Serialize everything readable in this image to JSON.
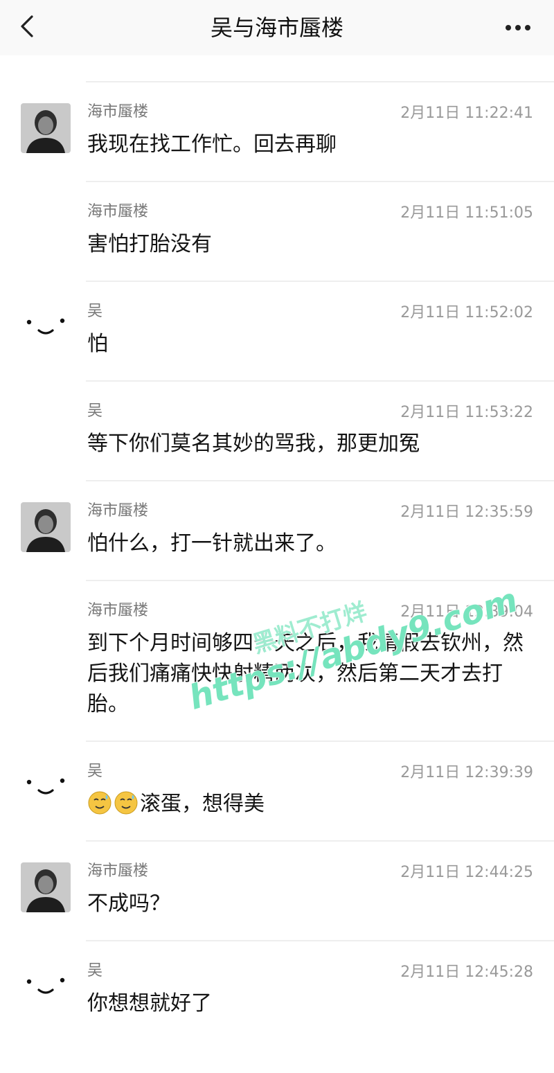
{
  "header": {
    "title": "吴与海市蜃楼"
  },
  "colors": {
    "header_bg": "#f9f9f9",
    "divider": "#eeeeee",
    "name_text": "#777777",
    "time_text": "#999999",
    "watermark": "#50dcaa"
  },
  "messages": [
    {
      "sender": "海市蜃楼",
      "time": "2月11日 11:22:41",
      "text": "我现在找工作忙。回去再聊",
      "avatar": "photo-avatar"
    },
    {
      "sender": "海市蜃楼",
      "time": "2月11日 11:51:05",
      "text": "害怕打胎没有",
      "avatar": null
    },
    {
      "sender": "吴",
      "time": "2月11日 11:52:02",
      "text": "怕",
      "avatar": "smiley-avatar"
    },
    {
      "sender": "吴",
      "time": "2月11日 11:53:22",
      "text": "等下你们莫名其妙的骂我，那更加冤",
      "avatar": null
    },
    {
      "sender": "海市蜃楼",
      "time": "2月11日 12:35:59",
      "text": "怕什么，打一针就出来了。",
      "avatar": "photo-avatar"
    },
    {
      "sender": "海市蜃楼",
      "time": "2月11日 12:39:04",
      "text": "到下个月时间够四十天之后，我请假去钦州，然后我们痛痛快快射精两次，然后第二天才去打胎。",
      "avatar": null
    },
    {
      "sender": "吴",
      "time": "2月11日 12:39:39",
      "text": "滚蛋，想得美",
      "avatar": "smiley-avatar",
      "emoji": [
        "sweat-smile-emoji",
        "sweat-smile-emoji"
      ]
    },
    {
      "sender": "海市蜃楼",
      "time": "2月11日 12:44:25",
      "text": "不成吗？",
      "avatar": "photo-avatar"
    },
    {
      "sender": "吴",
      "time": "2月11日 12:45:28",
      "text": "你想想就好了",
      "avatar": "smiley-avatar"
    }
  ],
  "watermark": {
    "top": "黑料不打烊",
    "url": "https://abdy9.com"
  }
}
